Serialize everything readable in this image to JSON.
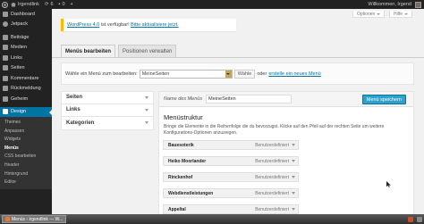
{
  "adminbar": {
    "site_name": "Irgendlink",
    "updates_count": "6",
    "comments_count": "0",
    "new_label": "+",
    "greeting": "Willkommen, Irgend"
  },
  "sidebar": {
    "items": [
      {
        "label": "Dashboard",
        "icon": "dashboard-icon"
      },
      {
        "label": "Jetpack",
        "icon": "jetpack-icon"
      },
      {
        "label": "Beiträge",
        "icon": "pin-icon"
      },
      {
        "label": "Medien",
        "icon": "media-icon"
      },
      {
        "label": "Links",
        "icon": "link-icon"
      },
      {
        "label": "Seiten",
        "icon": "page-icon"
      },
      {
        "label": "Kommentare",
        "icon": "comment-icon"
      },
      {
        "label": "Rückmeldung",
        "icon": "feedback-icon"
      },
      {
        "label": "Geheim",
        "icon": "lock-icon"
      },
      {
        "label": "Design",
        "icon": "brush-icon"
      }
    ],
    "submenu": [
      "Themes",
      "Anpassen",
      "Widgets",
      "Menüs",
      "CSS bearbeiten",
      "Header",
      "Hintergrund",
      "Editor"
    ]
  },
  "screen_options": {
    "options_label": "Optionen",
    "help_label": "Hilfe"
  },
  "notice": {
    "prefix": "WordPress 4.0",
    "text": " ist verfügbar! ",
    "link": "Bitte aktualisiere jetzt."
  },
  "tabs": {
    "edit_menus": "Menüs bearbeiten",
    "manage_locations": "Positionen verwalten"
  },
  "select_bar": {
    "label": "Wähle ein Menü zum bearbeiten:",
    "selected": "MeineSeiten",
    "choose_button": "Wähle",
    "or_text": "oder",
    "create_link": "erstelle ein neues Menü"
  },
  "accordion": [
    "Seiten",
    "Links",
    "Kategorien"
  ],
  "menu_panel": {
    "name_label": "Name des Menüs",
    "name_value": "MeineSeiten",
    "save_button": "Menü speichern",
    "heading": "Menüstruktur",
    "description": "Bringe die Elemente in die Reihenfolge die du bevorzugst. Klicke auf den Pfeil auf der rechten Seite um weitere Konfigurations-Optionen anzuzeigen."
  },
  "menu_items": [
    {
      "title": "Bauesoterik",
      "type": "Benutzerdefiniert"
    },
    {
      "title": "Heiko Moorlander",
      "type": "Benutzerdefiniert"
    },
    {
      "title": "Rinckenhof",
      "type": "Benutzerdefiniert"
    },
    {
      "title": "Webdienstleistungen",
      "type": "Benutzerdefiniert"
    },
    {
      "title": "Appeltal",
      "type": "Benutzerdefiniert"
    }
  ],
  "taskbar": {
    "window_title": "Menüs ‹ irgendlink — W..."
  },
  "colors": {
    "admin_blue": "#0074a2",
    "notice_yellow": "#ffba00",
    "button_blue": "#2ea2cc"
  }
}
